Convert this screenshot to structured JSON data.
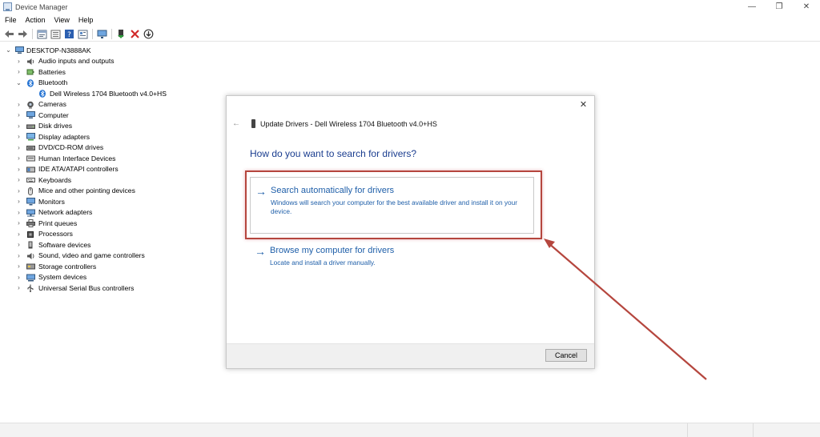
{
  "window": {
    "title": "Device Manager",
    "controls": {
      "minimize": "—",
      "restore": "❐",
      "close": "✕"
    }
  },
  "menu": [
    "File",
    "Action",
    "View",
    "Help"
  ],
  "toolbar": [
    "back-icon",
    "forward-icon",
    "properties-icon",
    "list-icon",
    "help-icon",
    "details-icon",
    "monitor-icon",
    "update-driver-icon",
    "uninstall-icon",
    "download-icon"
  ],
  "tree": {
    "root": "DESKTOP-N3888AK",
    "items": [
      {
        "label": "Audio inputs and outputs",
        "icon": "speaker-icon",
        "expanded": false
      },
      {
        "label": "Batteries",
        "icon": "battery-icon",
        "expanded": false
      },
      {
        "label": "Bluetooth",
        "icon": "bluetooth-icon",
        "expanded": true
      },
      {
        "label": "Dell Wireless 1704 Bluetooth v4.0+HS",
        "icon": "bluetooth-icon",
        "child": true
      },
      {
        "label": "Cameras",
        "icon": "camera-icon",
        "expanded": false
      },
      {
        "label": "Computer",
        "icon": "computer-icon",
        "expanded": false
      },
      {
        "label": "Disk drives",
        "icon": "disk-icon",
        "expanded": false
      },
      {
        "label": "Display adapters",
        "icon": "display-icon",
        "expanded": false
      },
      {
        "label": "DVD/CD-ROM drives",
        "icon": "dvd-icon",
        "expanded": false
      },
      {
        "label": "Human Interface Devices",
        "icon": "hid-icon",
        "expanded": false
      },
      {
        "label": "IDE ATA/ATAPI controllers",
        "icon": "ide-icon",
        "expanded": false
      },
      {
        "label": "Keyboards",
        "icon": "keyboard-icon",
        "expanded": false
      },
      {
        "label": "Mice and other pointing devices",
        "icon": "mouse-icon",
        "expanded": false
      },
      {
        "label": "Monitors",
        "icon": "monitor-icon",
        "expanded": false
      },
      {
        "label": "Network adapters",
        "icon": "network-icon",
        "expanded": false
      },
      {
        "label": "Print queues",
        "icon": "printer-icon",
        "expanded": false
      },
      {
        "label": "Processors",
        "icon": "processor-icon",
        "expanded": false
      },
      {
        "label": "Software devices",
        "icon": "software-icon",
        "expanded": false
      },
      {
        "label": "Sound, video and game controllers",
        "icon": "sound-icon",
        "expanded": false
      },
      {
        "label": "Storage controllers",
        "icon": "storage-icon",
        "expanded": false
      },
      {
        "label": "System devices",
        "icon": "system-icon",
        "expanded": false
      },
      {
        "label": "Universal Serial Bus controllers",
        "icon": "usb-icon",
        "expanded": false
      }
    ]
  },
  "dialog": {
    "title": "Update Drivers - Dell Wireless 1704 Bluetooth v4.0+HS",
    "heading": "How do you want to search for drivers?",
    "option1": {
      "title": "Search automatically for drivers",
      "description": "Windows will search your computer for the best available driver and install it on your device."
    },
    "option2": {
      "title": "Browse my computer for drivers",
      "description": "Locate and install a driver manually."
    },
    "cancel_label": "Cancel",
    "close_glyph": "✕",
    "back_glyph": "←",
    "arrow_glyph": "→"
  },
  "colors": {
    "link_blue": "#1f5fa9",
    "heading_blue": "#1a3d8f",
    "annotation_red": "#b5463e"
  }
}
